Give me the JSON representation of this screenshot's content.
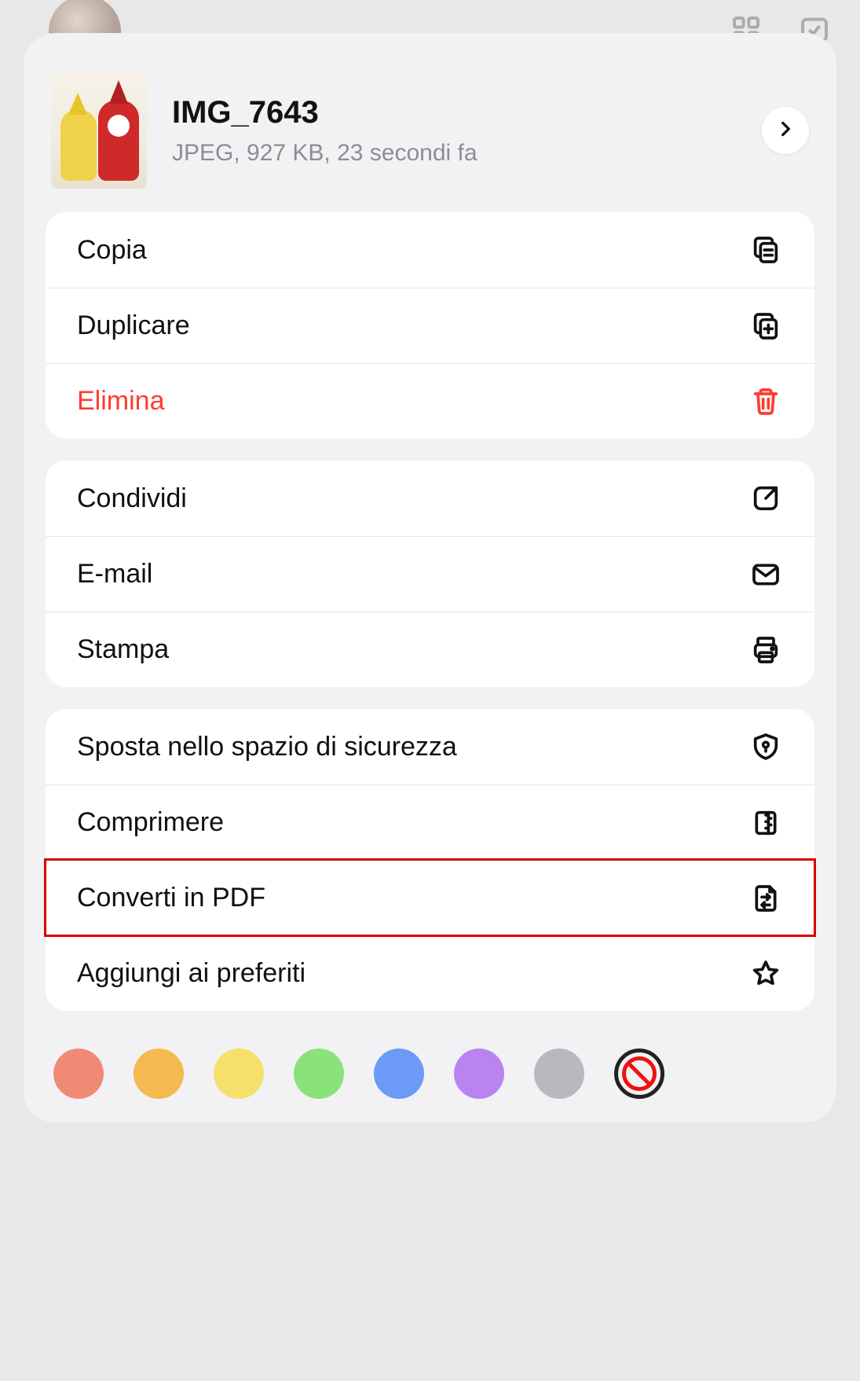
{
  "file": {
    "title": "IMG_7643",
    "subtitle": "JPEG, 927 KB, 23 secondi fa"
  },
  "groups": [
    {
      "items": [
        {
          "label": "Copia",
          "icon": "copy",
          "name": "action-copy"
        },
        {
          "label": "Duplicare",
          "icon": "duplicate",
          "name": "action-duplicate"
        },
        {
          "label": "Elimina",
          "icon": "trash",
          "name": "action-delete",
          "destructive": true
        }
      ]
    },
    {
      "items": [
        {
          "label": "Condividi",
          "icon": "share",
          "name": "action-share"
        },
        {
          "label": "E-mail",
          "icon": "mail",
          "name": "action-email"
        },
        {
          "label": "Stampa",
          "icon": "print",
          "name": "action-print"
        }
      ]
    },
    {
      "items": [
        {
          "label": "Sposta nello spazio di sicurezza",
          "icon": "shield",
          "name": "action-move-to-safe"
        },
        {
          "label": "Comprimere",
          "icon": "zip",
          "name": "action-compress"
        },
        {
          "label": "Converti in PDF",
          "icon": "convert",
          "name": "action-convert-pdf",
          "highlighted": true
        },
        {
          "label": "Aggiungi ai preferiti",
          "icon": "star",
          "name": "action-favorite"
        }
      ]
    }
  ],
  "colors": [
    "#f08a75",
    "#f4b94f",
    "#f4e06a",
    "#8be27a",
    "#6b9af7",
    "#b983f2",
    "#b8b8bd"
  ]
}
